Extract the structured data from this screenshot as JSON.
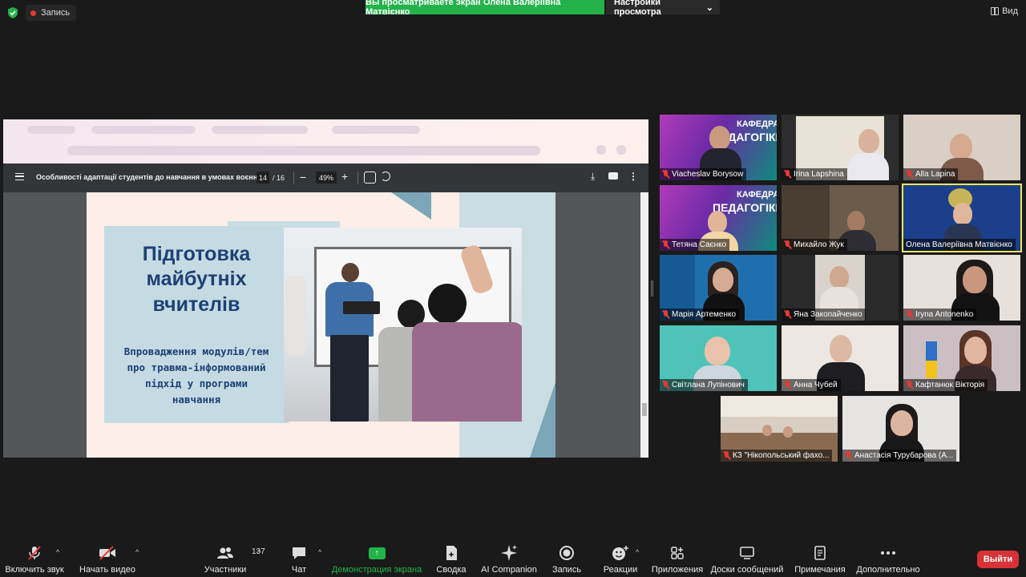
{
  "meeting": {
    "record_indicator": "Запись",
    "share_banner": "Вы просматриваете экран Олена Валеріївна Матвієнко",
    "view_options": "Настройки просмотра",
    "view_button": "Вид"
  },
  "pdf": {
    "title": "Особливості адаптації студентів до навчання в умовах воєнн...",
    "page_current": "14",
    "page_total": "/ 16",
    "zoom": "49%"
  },
  "slide": {
    "title": "Підготовка майбутніх вчителів",
    "subtitle": "Впровадження модулів/тем про травма-інформований підхід у програми навчання"
  },
  "participants": [
    {
      "name": "Viacheslav Borysow",
      "muted": true,
      "active": false
    },
    {
      "name": "Irina Lapshina",
      "muted": true,
      "active": false
    },
    {
      "name": "Alla Lapina",
      "muted": true,
      "active": false
    },
    {
      "name": "Тетяна Саєнко",
      "muted": true,
      "active": false
    },
    {
      "name": "Михайло Жук",
      "muted": true,
      "active": false
    },
    {
      "name": "Олена Валеріївна Матвієнко",
      "muted": false,
      "active": true
    },
    {
      "name": "Марія Артеменко",
      "muted": true,
      "active": false
    },
    {
      "name": "Яна Закопайченко",
      "muted": true,
      "active": false
    },
    {
      "name": "Iryna Antonenko",
      "muted": true,
      "active": false
    },
    {
      "name": "Світлана Лупінович",
      "muted": true,
      "active": false
    },
    {
      "name": "Анна Чубей",
      "muted": true,
      "active": false
    },
    {
      "name": "Кафтанюк Вікторія",
      "muted": true,
      "active": false
    },
    {
      "name": "КЗ \"Нікопольський фахо...",
      "muted": true,
      "active": false
    },
    {
      "name": "Анастасія Турубарова (А...",
      "muted": true,
      "active": false
    }
  ],
  "toolbar": {
    "mute": "Включить звук",
    "video": "Начать видео",
    "participants": "Участники",
    "participants_count": "137",
    "chat": "Чат",
    "share": "Демонстрация экрана",
    "summary": "Сводка",
    "ai": "AI Companion",
    "record": "Запись",
    "reactions": "Реакции",
    "apps": "Приложения",
    "boards": "Доски сообщений",
    "notes": "Примечания",
    "more": "Дополнительно",
    "leave": "Выйти"
  },
  "colors": {
    "share_green": "#23b34a",
    "leave_red": "#d83236",
    "active_speaker": "#f2e45b",
    "slide_navy": "#1d4175"
  }
}
